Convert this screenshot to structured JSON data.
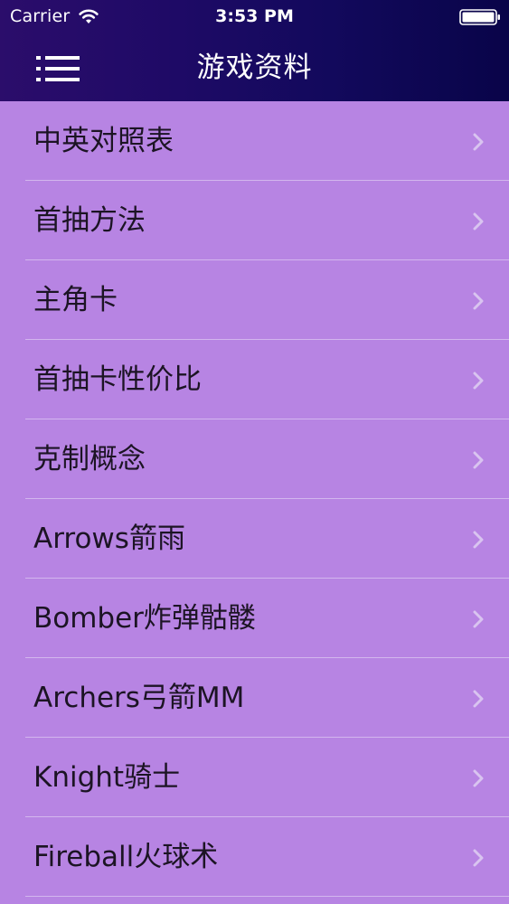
{
  "status_bar": {
    "carrier": "Carrier",
    "time": "3:53 PM",
    "icons": [
      "wifi-icon",
      "battery-icon"
    ]
  },
  "nav_bar": {
    "title": "游戏资料",
    "menu_icon": "hamburger-menu-icon"
  },
  "list": {
    "items": [
      {
        "label": "中英对照表"
      },
      {
        "label": "首抽方法"
      },
      {
        "label": "主角卡"
      },
      {
        "label": "首抽卡性价比"
      },
      {
        "label": "克制概念"
      },
      {
        "label": "Arrows箭雨"
      },
      {
        "label": "Bomber炸弹骷髅"
      },
      {
        "label": "Archers弓箭MM"
      },
      {
        "label": "Knight骑士"
      },
      {
        "label": "Fireball火球术"
      }
    ],
    "row_icon": "chevron-right-icon"
  },
  "colors": {
    "header_gradient_start": "#2b0d6b",
    "header_gradient_end": "#090449",
    "list_background": "#b784e3",
    "separator": "#d3b6ee",
    "item_text": "#1c1424",
    "chevron": "#d9c4f0"
  }
}
